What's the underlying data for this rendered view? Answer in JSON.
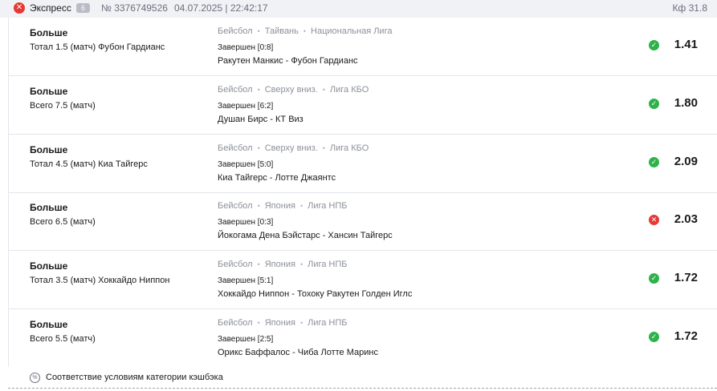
{
  "header": {
    "title": "Экспресс",
    "count": "6",
    "bet_id": "№ 3376749526",
    "datetime": "04.07.2025 | 22:42:17",
    "coef": "Кф 31.8"
  },
  "bets": [
    {
      "type": "Больше",
      "desc": "Тотал 1.5 (матч) Фубон Гардианс",
      "sport": "Бейсбол",
      "region": "Тайвань",
      "league": "Национальная Лига",
      "status": "Завершен [0:8]",
      "match": "Ракутен Манкис - Фубон Гардианс",
      "result": "win",
      "result_glyph": "✓",
      "odd": "1.41"
    },
    {
      "type": "Больше",
      "desc": "Всего 7.5 (матч)",
      "sport": "Бейсбол",
      "region": "Сверху вниз.",
      "league": "Лига КБО",
      "status": "Завершен [6:2]",
      "match": "Душан Бирс - КТ Виз",
      "result": "win",
      "result_glyph": "✓",
      "odd": "1.80"
    },
    {
      "type": "Больше",
      "desc": "Тотал 4.5 (матч) Киа Тайгерс",
      "sport": "Бейсбол",
      "region": "Сверху вниз.",
      "league": "Лига КБО",
      "status": "Завершен [5:0]",
      "match": "Киа Тайгерс - Лотте Джаянтс",
      "result": "win",
      "result_glyph": "✓",
      "odd": "2.09"
    },
    {
      "type": "Больше",
      "desc": "Всего 6.5 (матч)",
      "sport": "Бейсбол",
      "region": "Япония",
      "league": "Лига НПБ",
      "status": "Завершен [0:3]",
      "match": "Йокогама Дена Бэйстарс - Хансин Тайгерс",
      "result": "lose",
      "result_glyph": "✕",
      "odd": "2.03"
    },
    {
      "type": "Больше",
      "desc": "Тотал 3.5 (матч) Хоккайдо Ниппон",
      "sport": "Бейсбол",
      "region": "Япония",
      "league": "Лига НПБ",
      "status": "Завершен [5:1]",
      "match": "Хоккайдо Ниппон - Тохоку Ракутен Голден Иглс",
      "result": "win",
      "result_glyph": "✓",
      "odd": "1.72"
    },
    {
      "type": "Больше",
      "desc": "Всего 5.5 (матч)",
      "sport": "Бейсбол",
      "region": "Япония",
      "league": "Лига НПБ",
      "status": "Завершен [2:5]",
      "match": "Орикс Баффалос - Чиба Лотте Маринс",
      "result": "win",
      "result_glyph": "✓",
      "odd": "1.72"
    }
  ],
  "cashback": {
    "icon_glyph": "%",
    "text": "Соответствие условиям категории кэшбэка"
  },
  "colors": {
    "win": "#2eb24a",
    "lose": "#e53935",
    "header_bg": "#f1f2f6"
  }
}
